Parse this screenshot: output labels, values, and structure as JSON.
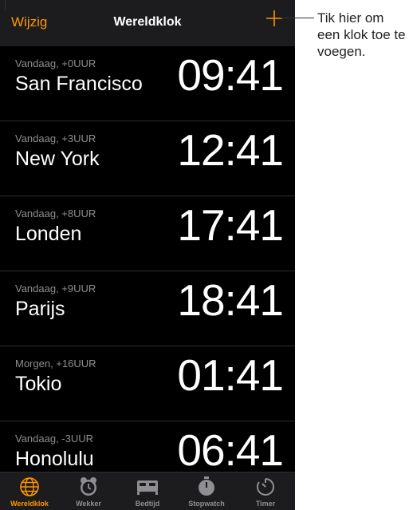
{
  "navbar": {
    "edit_label": "Wijzig",
    "title": "Wereldklok",
    "add_icon": "plus-icon"
  },
  "clocks": [
    {
      "sub": "Vandaag, +0UUR",
      "city": "San Francisco",
      "time": "09:41"
    },
    {
      "sub": "Vandaag, +3UUR",
      "city": "New York",
      "time": "12:41"
    },
    {
      "sub": "Vandaag, +8UUR",
      "city": "Londen",
      "time": "17:41"
    },
    {
      "sub": "Vandaag, +9UUR",
      "city": "Parijs",
      "time": "18:41"
    },
    {
      "sub": "Morgen, +16UUR",
      "city": "Tokio",
      "time": "01:41"
    },
    {
      "sub": "Vandaag, -3UUR",
      "city": "Honolulu",
      "time": "06:41"
    }
  ],
  "tabs": [
    {
      "label": "Wereldklok",
      "icon": "globe-icon",
      "active": true
    },
    {
      "label": "Wekker",
      "icon": "alarm-clock-icon",
      "active": false
    },
    {
      "label": "Bedtijd",
      "icon": "bed-icon",
      "active": false
    },
    {
      "label": "Stopwatch",
      "icon": "stopwatch-icon",
      "active": false
    },
    {
      "label": "Timer",
      "icon": "timer-icon",
      "active": false
    }
  ],
  "callout": {
    "text": "Tik hier om een klok toe te voegen."
  },
  "colors": {
    "accent": "#ff9500",
    "background": "#000000",
    "bar": "#1c1c1e",
    "inactive": "#8e8e93"
  }
}
